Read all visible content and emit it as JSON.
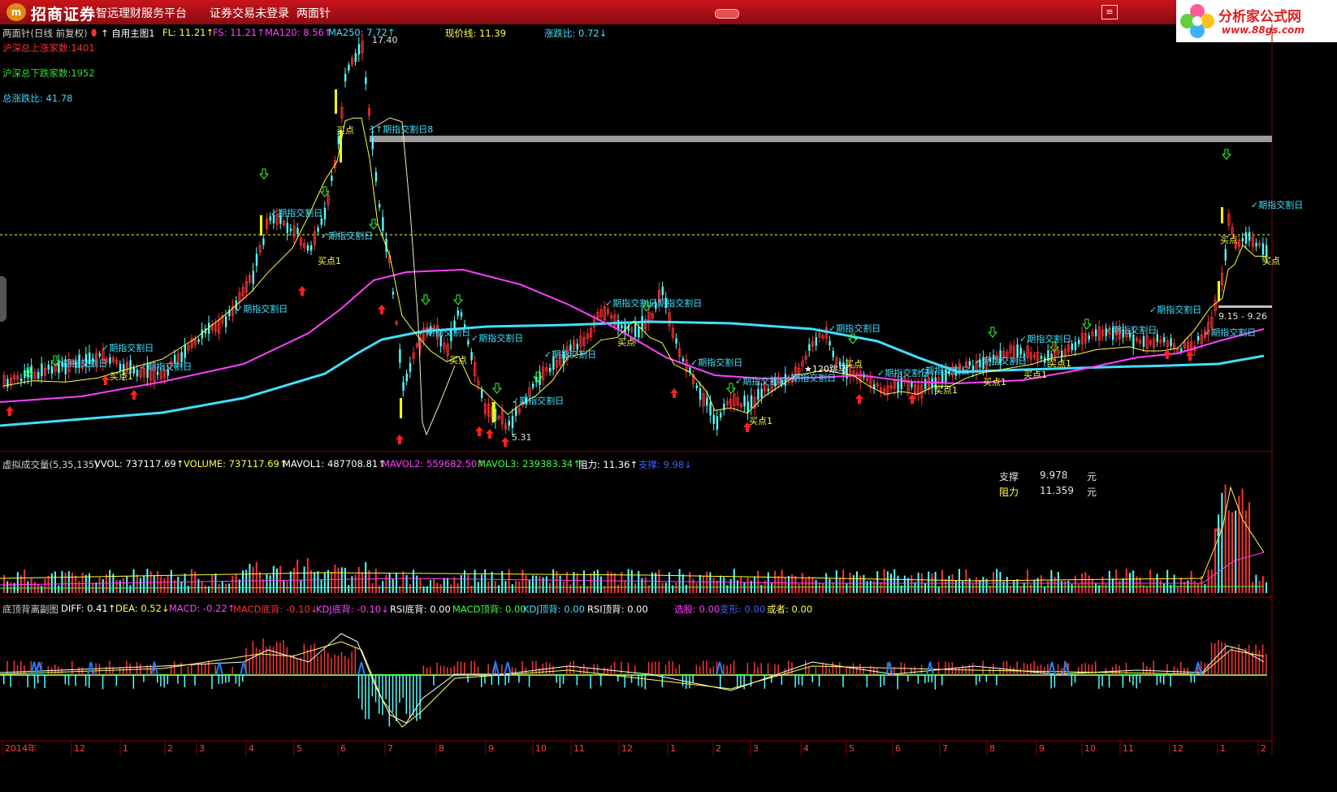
{
  "titlebar": {
    "logo_glyph": "m",
    "brand": "招商证券",
    "subtitle": "智远理财服务平台",
    "login_status": "证券交易未登录",
    "current_formula": "两面针"
  },
  "watermark": {
    "name": "分析家公式网",
    "url": "www.88gs.com"
  },
  "main_header": [
    {
      "text": "两面针(日线 前复权)",
      "color": "#d0d0d0"
    },
    {
      "text": "⬮",
      "color": "#ff3030"
    },
    {
      "text": "↑ 自用主图1",
      "color": "#ffffff"
    },
    {
      "text": "FL: 11.21↑",
      "color": "#ffff40"
    },
    {
      "text": "FS: 11.21↑",
      "color": "#ff40ff"
    },
    {
      "text": "MA120: 8.56↑",
      "color": "#ff40ff"
    },
    {
      "text": "MA250: 7.72↑",
      "color": "#40e0ff"
    },
    {
      "text": "现价线: 11.39",
      "color": "#ffff40"
    },
    {
      "text": "涨跌比: 0.72↓",
      "color": "#40e0ff"
    }
  ],
  "market_stats": [
    {
      "text": "沪深总上涨家数:1401",
      "color": "#ff3030"
    },
    {
      "text": "沪深总下跌家数:1952",
      "color": "#30e030"
    },
    {
      "text": "总涨跌比: 41.78",
      "color": "#40d0ff"
    }
  ],
  "vol_header": [
    {
      "text": "虚拟成交量(5,35,135)",
      "color": "#d0d0d0"
    },
    {
      "text": "VVOL: 737117.69↑",
      "color": "#ffffff"
    },
    {
      "text": "VOLUME: 737117.69↑",
      "color": "#ffff40"
    },
    {
      "text": "MAVOL1: 487708.81↑",
      "color": "#ffffff"
    },
    {
      "text": "MAVOL2: 559682.50↑",
      "color": "#ff40ff"
    },
    {
      "text": "MAVOL3: 239383.34↑",
      "color": "#40ff40"
    },
    {
      "text": "阻力: 11.36↑",
      "color": "#ffffff"
    },
    {
      "text": "支撑: 9.98↓",
      "color": "#4060ff"
    }
  ],
  "support_resist": {
    "support_label": "支撑",
    "support_value": "9.978",
    "support_unit": "元",
    "resist_label": "阻力",
    "resist_value": "11.359",
    "resist_unit": "元"
  },
  "macd_header": [
    {
      "text": "底顶背离副图",
      "color": "#d0d0d0"
    },
    {
      "text": "DIFF: 0.41↑",
      "color": "#ffffff"
    },
    {
      "text": "DEA: 0.52↓",
      "color": "#ffff40"
    },
    {
      "text": "MACD: -0.22↑",
      "color": "#ff40ff"
    },
    {
      "text": "MACD底背: -0.10↓",
      "color": "#ff3030"
    },
    {
      "text": "KDJ底背: -0.10↓",
      "color": "#ff40ff"
    },
    {
      "text": "RSI底背: 0.00",
      "color": "#ffffff"
    },
    {
      "text": "MACD顶背: 0.00",
      "color": "#40ff40"
    },
    {
      "text": "KDJ顶背: 0.00",
      "color": "#40e0ff"
    },
    {
      "text": "RSI顶背: 0.00",
      "color": "#ffffff"
    },
    {
      "text": "选股: 0.00",
      "color": "#ff40ff"
    },
    {
      "text": "变形: 0.00",
      "color": "#4060ff"
    },
    {
      "text": "或者: 0.00",
      "color": "#ffff40"
    }
  ],
  "price_annotations": {
    "high": "17.40",
    "low": "5.31",
    "range_label": "9.15 - 9.26",
    "jump_label": "★120跳马"
  },
  "signal_labels": {
    "futures": "期指交割日",
    "buy": "买点",
    "buy1": "买点1",
    "up": "上涨",
    "check": "✓"
  },
  "time_axis": [
    "2014年",
    "12",
    "1",
    "2",
    "3",
    "4",
    "5",
    "6",
    "7",
    "8",
    "9",
    "10",
    "11",
    "12",
    "1",
    "2",
    "3",
    "4",
    "5",
    "6",
    "7",
    "8",
    "9",
    "10",
    "11",
    "12",
    "1",
    "2"
  ],
  "colors": {
    "up": "#ff3232",
    "down": "#54ffff",
    "fl": "#ffff40",
    "ma120": "#ff40ff",
    "ma250": "#40e0ff"
  }
}
